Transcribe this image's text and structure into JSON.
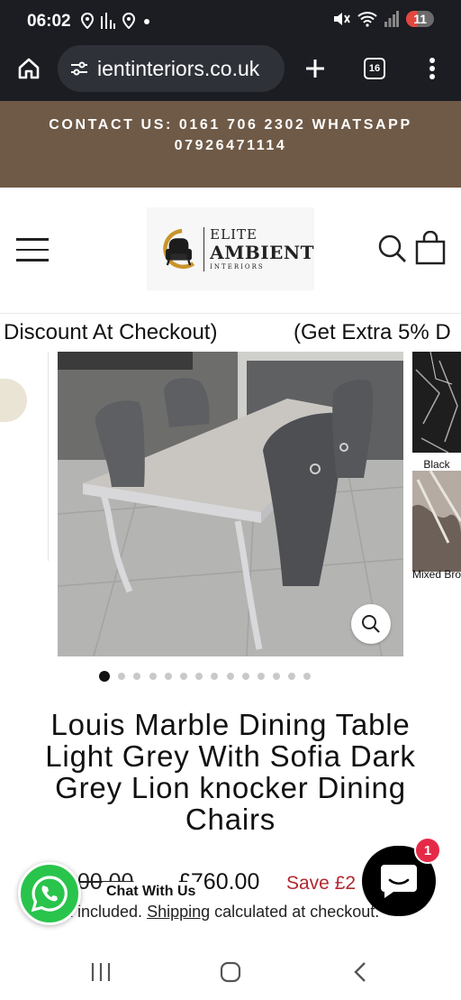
{
  "status_bar": {
    "time": "06:02",
    "battery": "11",
    "icons": [
      "location-icon",
      "signal-bars-icon",
      "location-icon",
      "dot-icon",
      "mute-icon",
      "wifi-icon",
      "cell-signal-icon",
      "battery-icon"
    ]
  },
  "browser": {
    "url": "ientinteriors.co.uk",
    "tab_count": "16",
    "icons": [
      "home-icon",
      "site-settings-icon",
      "plus-icon",
      "tabs-icon",
      "more-vert-icon"
    ]
  },
  "announcement": {
    "text": "CONTACT US: 0161 706 2302 WHATSAPP 07926471114"
  },
  "header": {
    "logo_line1": "ELITE",
    "logo_line2": "AMBIENT",
    "logo_line3": "INTERIORS"
  },
  "marquee": {
    "text_a": "Discount At Checkout)",
    "text_b": "(Get Extra 5% D"
  },
  "gallery": {
    "swatches": [
      {
        "label": "Black"
      },
      {
        "label": "Mixed Bro"
      }
    ],
    "dot_count": 14,
    "active_dot": 1
  },
  "product": {
    "title": "Louis Marble Dining Table Light Grey With Sofia Dark Grey Lion knocker Dining Chairs",
    "old_price": "900.00",
    "price": "£760.00",
    "save": "Save £2",
    "tax_prefix": "x included.",
    "shipping_link": "Shipping",
    "tax_suffix": "calculated at checkout."
  },
  "whatsapp": {
    "label": "Chat With Us"
  },
  "chat": {
    "badge": "1"
  },
  "colors": {
    "announcement_bg": "#6f5a47",
    "sale_red": "#b0292f",
    "whatsapp_green": "#29c44c",
    "badge_red": "#e52a48",
    "status_bar_bg": "#1b1d22"
  }
}
